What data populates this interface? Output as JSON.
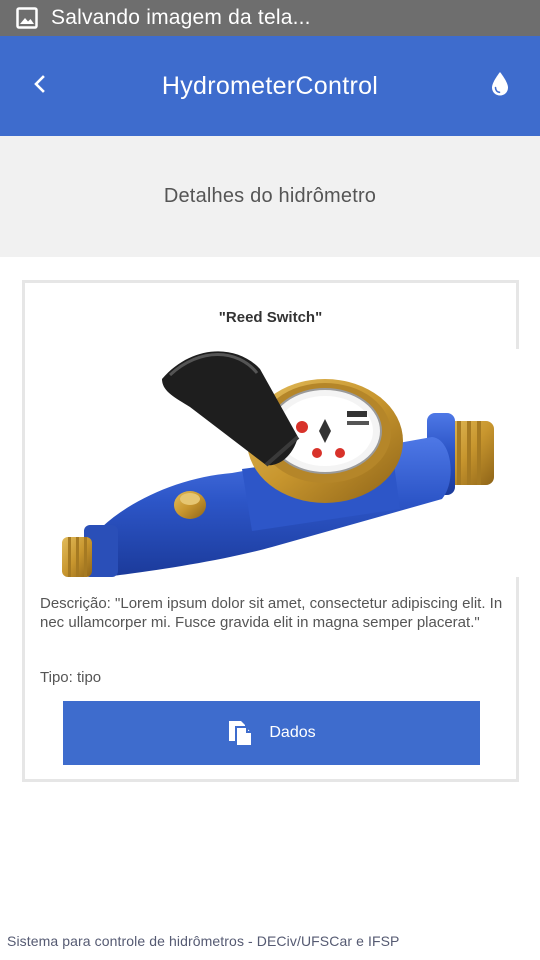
{
  "status_bar": {
    "icon": "image-icon",
    "text": "Salvando imagem da tela..."
  },
  "app_bar": {
    "back_icon": "chevron-left-icon",
    "title": "HydrometerControl",
    "action_icon": "water-drop-icon"
  },
  "subheader": {
    "title": "Detalhes do hidrômetro"
  },
  "card": {
    "title": "\"Reed Switch\"",
    "image": "water-meter-photo",
    "description": "Descrição: \"Lorem ipsum dolor sit amet, consectetur adipiscing elit. In nec ullamcorper mi. Fusce gravida elit in magna semper placerat.\"",
    "type": "Tipo: tipo",
    "button_icon": "copy-files-icon",
    "button_label": "Dados"
  },
  "footer": {
    "text": "Sistema para controle de hidrômetros - DECiv/UFSCar e IFSP"
  },
  "colors": {
    "primary": "#3e6ccd",
    "status_bar": "#6e6e6e",
    "subheader_bg": "#f1f1f1",
    "meter_body": "#2f55c4",
    "meter_brass": "#c89a35"
  }
}
